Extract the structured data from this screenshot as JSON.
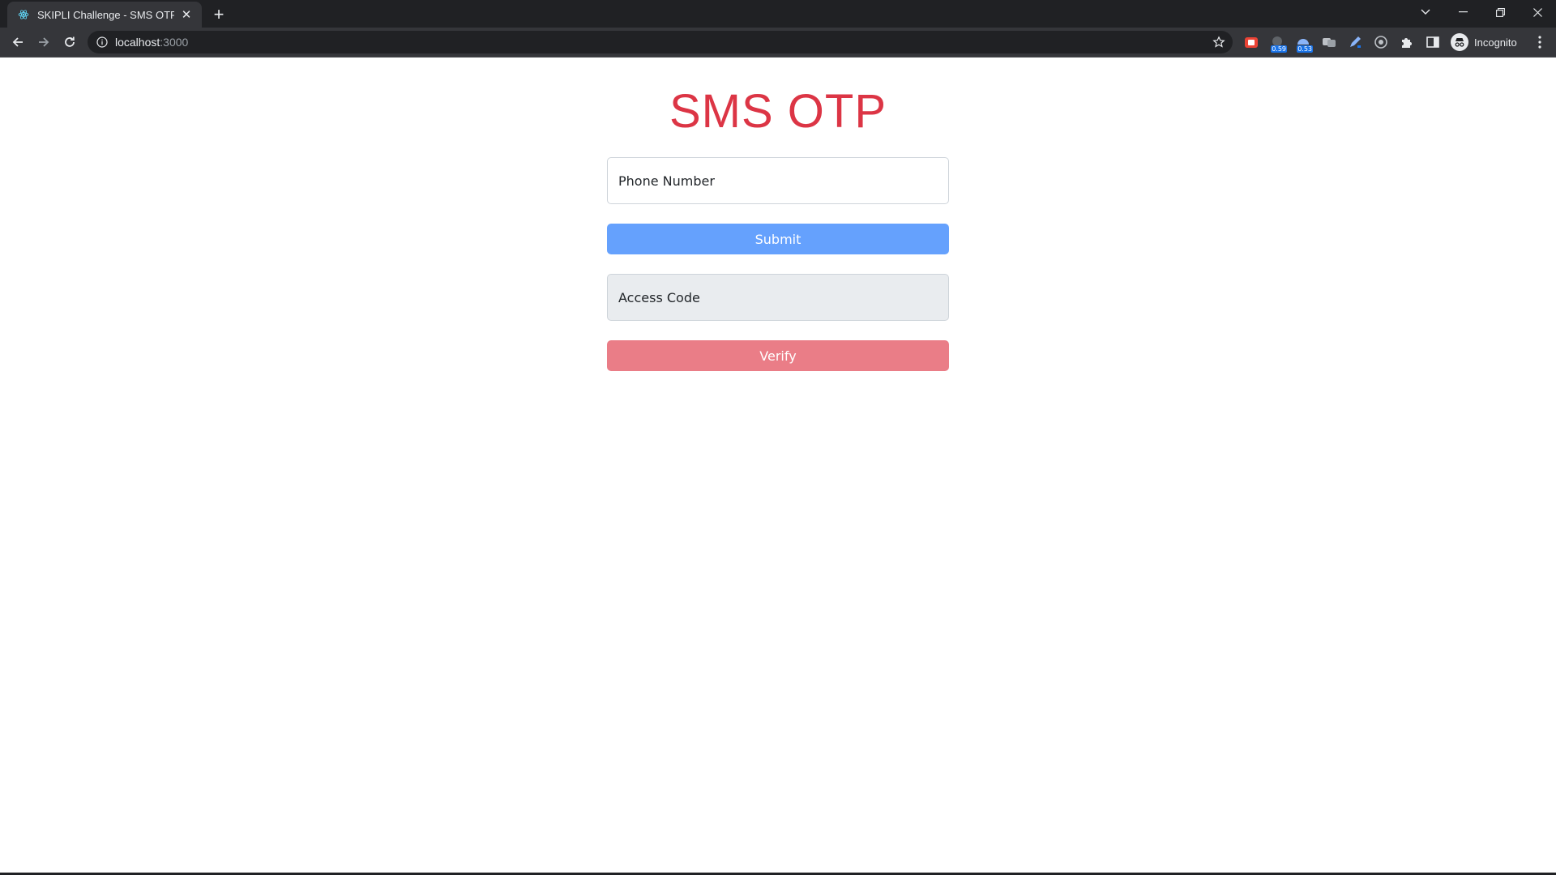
{
  "browser": {
    "tab": {
      "title": "SKIPLI Challenge - SMS OTP APP",
      "favicon": "react-icon"
    },
    "address": {
      "host": "localhost",
      "port": ":3000"
    },
    "profile_label": "Incognito",
    "extensions": [
      {
        "icon": "extension-red-icon",
        "badge": ""
      },
      {
        "icon": "extension-blue-a-icon",
        "badge": "0.59"
      },
      {
        "icon": "extension-blue-b-icon",
        "badge": "0.53"
      },
      {
        "icon": "extension-translate-icon",
        "badge": ""
      },
      {
        "icon": "extension-pen-icon",
        "badge": ""
      },
      {
        "icon": "extension-target-icon",
        "badge": ""
      },
      {
        "icon": "puzzle-icon",
        "badge": ""
      },
      {
        "icon": "side-panel-icon",
        "badge": ""
      }
    ]
  },
  "app": {
    "title": "SMS OTP",
    "phone_placeholder": "Phone Number",
    "submit_label": "Submit",
    "code_placeholder": "Access Code",
    "verify_label": "Verify"
  },
  "colors": {
    "title": "#dc3545",
    "submit": "#65a1fd",
    "verify": "#ea7d87",
    "code_bg": "#e9ecef"
  }
}
